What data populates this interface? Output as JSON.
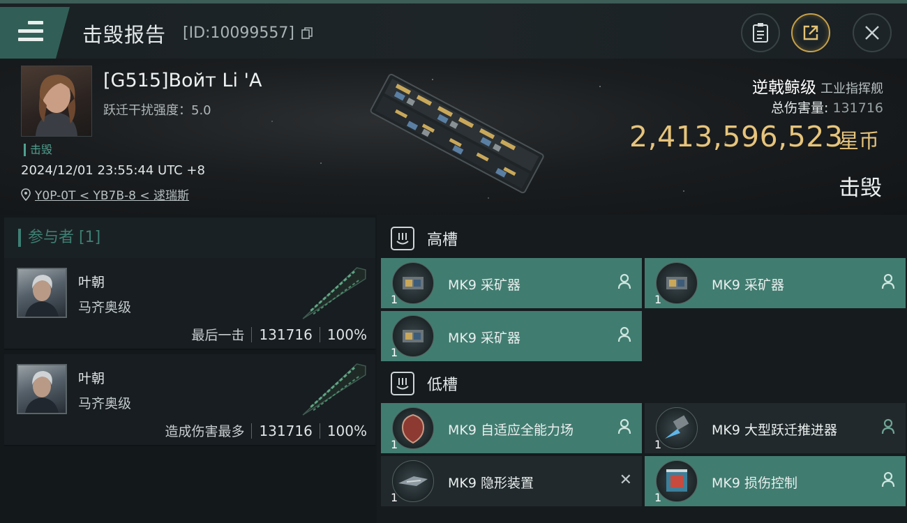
{
  "header": {
    "title": "击毁报告",
    "report_id": "[ID:10099557]"
  },
  "banner": {
    "pilot_name": "[G515]Войт Li 'A",
    "warp_strength": "跃迁干扰强度：5.0",
    "status": "击毁",
    "timestamp": "2024/12/01 23:55:44 UTC +8",
    "location": "Y0P-0T < YB7B-8 < 逑瑞斯",
    "ship_name": "逆戟鲸级",
    "ship_class": "工业指挥舰",
    "total_damage_label": "总伤害量:",
    "total_damage_value": "131716",
    "isk_value": "2,413,596,523",
    "isk_unit": "星币",
    "result": "击毁"
  },
  "participants": {
    "header": "参与者 [1]",
    "rows": [
      {
        "name": "叶朝",
        "ship": "马齐奥级",
        "role": "最后一击",
        "damage": "131716",
        "percent": "100%"
      },
      {
        "name": "叶朝",
        "ship": "马齐奥级",
        "role": "造成伤害最多",
        "damage": "131716",
        "percent": "100%"
      }
    ]
  },
  "slots": {
    "high_label": "高槽",
    "low_label": "低槽",
    "high": [
      {
        "name": "MK9 采矿器",
        "qty": "1"
      },
      {
        "name": "MK9 采矿器",
        "qty": "1"
      },
      {
        "name": "MK9 采矿器",
        "qty": "1"
      }
    ],
    "low": [
      {
        "name": "MK9 自适应全能力场",
        "qty": "1"
      },
      {
        "name": "MK9 大型跃迁推进器",
        "qty": "1"
      },
      {
        "name": "MK9 隐形装置",
        "qty": "1"
      },
      {
        "name": "MK9 损伤控制",
        "qty": "1"
      }
    ]
  },
  "colors": {
    "accent": "#417c70",
    "isk_gold": "#e6c47c",
    "header_amber": "#c7a14a"
  },
  "icons": [
    "menu-icon",
    "copy-icon",
    "clipboard-icon",
    "share-icon",
    "close-icon",
    "location-pin-icon",
    "shield-slot-icon",
    "user-icon",
    "x-icon"
  ]
}
